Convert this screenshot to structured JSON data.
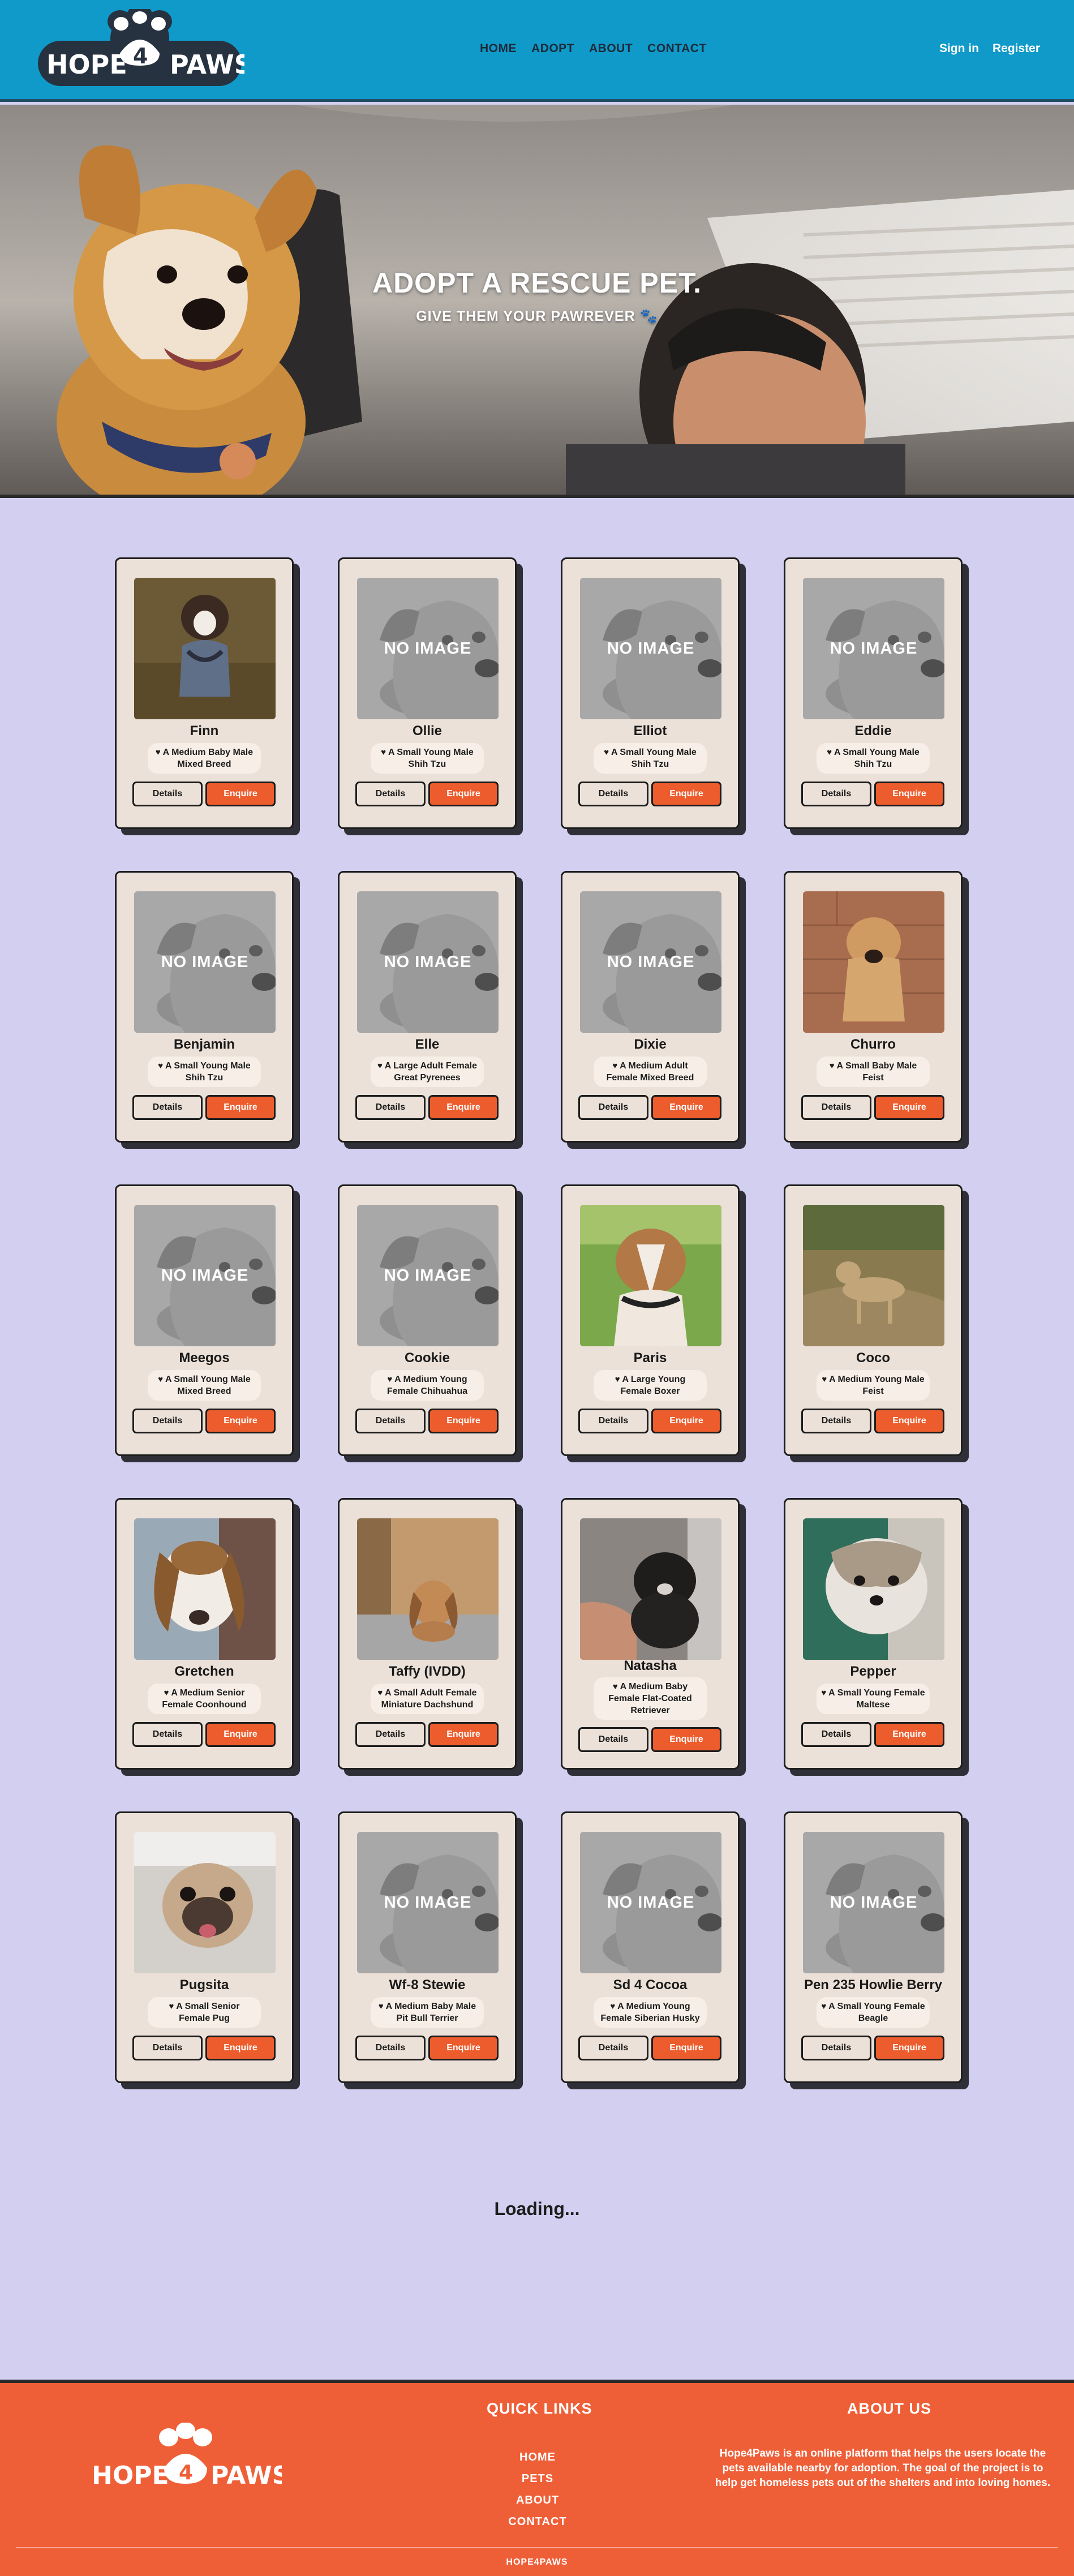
{
  "brand": {
    "name": "HOPE4PAWS"
  },
  "nav": {
    "items": [
      "HOME",
      "ADOPT",
      "ABOUT",
      "CONTACT"
    ]
  },
  "auth": {
    "sign_in": "Sign in",
    "register": "Register"
  },
  "hero": {
    "title": "ADOPT A RESCUE PET.",
    "subtitle": "GIVE THEM YOUR PAWREVER",
    "paw": "🐾"
  },
  "card_labels": {
    "details": "Details",
    "enquire": "Enquire",
    "no_image": "NO IMAGE",
    "heart": "♥"
  },
  "pets": [
    {
      "name": "Finn",
      "desc": "A Medium Baby Male Mixed Breed",
      "image": "photo-puppy-harness"
    },
    {
      "name": "Ollie",
      "desc": "A Small Young Male Shih Tzu",
      "image": "no-image"
    },
    {
      "name": "Elliot",
      "desc": "A Small Young Male Shih Tzu",
      "image": "no-image"
    },
    {
      "name": "Eddie",
      "desc": "A Small Young Male Shih Tzu",
      "image": "no-image"
    },
    {
      "name": "Benjamin",
      "desc": "A Small Young Male Shih Tzu",
      "image": "no-image"
    },
    {
      "name": "Elle",
      "desc": "A Large Adult Female Great Pyrenees",
      "image": "no-image"
    },
    {
      "name": "Dixie",
      "desc": "A Medium Adult Female Mixed Breed",
      "image": "no-image"
    },
    {
      "name": "Churro",
      "desc": "A Small Baby Male Feist",
      "image": "photo-puppy-bricks"
    },
    {
      "name": "Meegos",
      "desc": "A Small Young Male Mixed Breed",
      "image": "no-image"
    },
    {
      "name": "Cookie",
      "desc": "A Medium Young Female Chihuahua",
      "image": "no-image"
    },
    {
      "name": "Paris",
      "desc": "A Large Young Female Boxer",
      "image": "photo-boxer-grass"
    },
    {
      "name": "Coco",
      "desc": "A Medium Young Male Feist",
      "image": "photo-dog-yard"
    },
    {
      "name": "Gretchen",
      "desc": "A Medium Senior Female Coonhound",
      "image": "photo-coonhound"
    },
    {
      "name": "Taffy (IVDD)",
      "desc": "A Small Adult Female Miniature Dachshund",
      "image": "photo-dachshund"
    },
    {
      "name": "Natasha",
      "desc": "A Medium Baby Female Flat-Coated Retriever",
      "image": "photo-black-puppy"
    },
    {
      "name": "Pepper",
      "desc": "A Small Young Female Maltese",
      "image": "photo-maltese"
    },
    {
      "name": "Pugsita",
      "desc": "A Small Senior Female Pug",
      "image": "photo-pug"
    },
    {
      "name": "Wf-8 Stewie",
      "desc": "A Medium Baby Male Pit Bull Terrier",
      "image": "no-image"
    },
    {
      "name": "Sd 4 Cocoa",
      "desc": "A Medium Young Female Siberian Husky",
      "image": "no-image"
    },
    {
      "name": "Pen 235 Howlie Berry",
      "desc": "A Small Young Female Beagle",
      "image": "no-image"
    }
  ],
  "loading": "Loading...",
  "footer": {
    "quick_links_title": "QUICK LINKS",
    "quick_links": [
      "HOME",
      "PETS",
      "ABOUT",
      "CONTACT"
    ],
    "about_title": "ABOUT US",
    "about_text": "Hope4Paws is an online platform that helps the users locate the pets available nearby for adoption. The goal of the project is to help get homeless pets out of the shelters and into loving homes.",
    "copyright": "HOPE4PAWS"
  },
  "colors": {
    "header": "#0f9ac9",
    "page": "#d2cff0",
    "card": "#ece1d8",
    "enquire": "#ec5c2c",
    "footer": "#ef5f37"
  }
}
